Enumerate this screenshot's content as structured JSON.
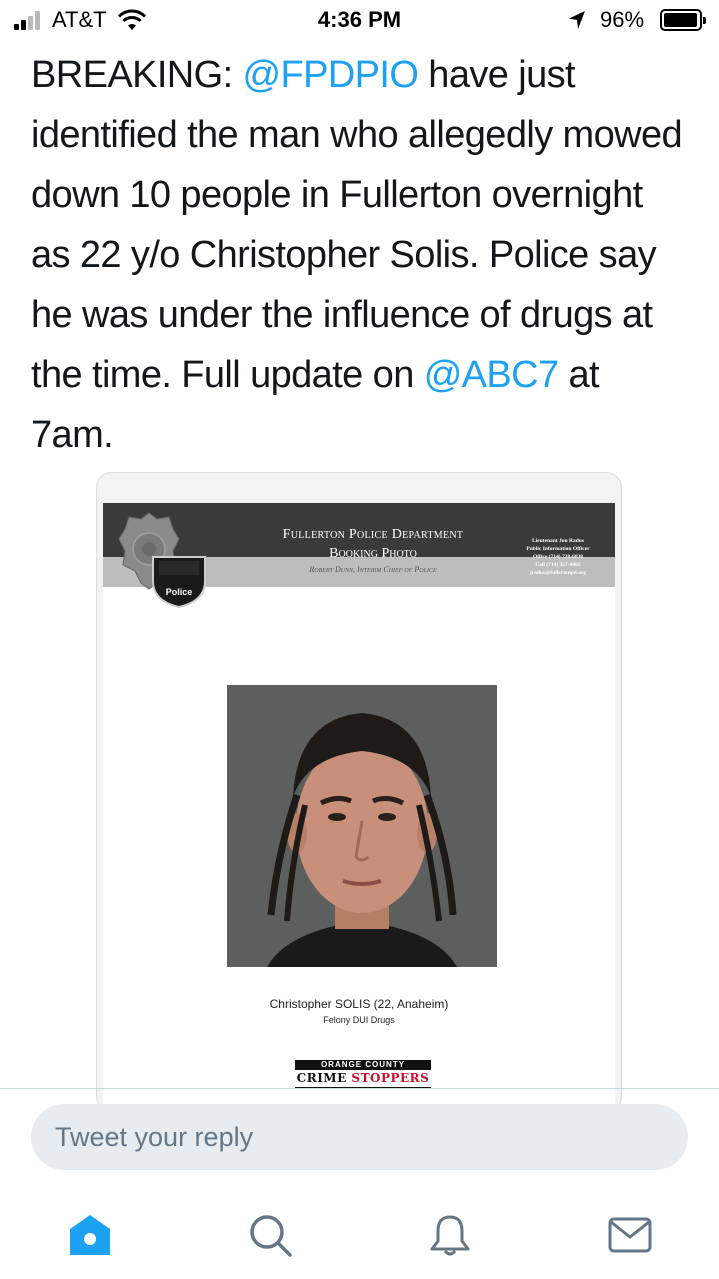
{
  "status_bar": {
    "carrier": "AT&T",
    "time": "4:36 PM",
    "battery_percent": "96%",
    "battery_level": 0.96,
    "signal_bars_filled": 2,
    "signal_bars_total": 4
  },
  "tweet": {
    "segments": [
      {
        "text": "BREAKING: ",
        "type": "text"
      },
      {
        "text": "@FPDPIO",
        "type": "mention"
      },
      {
        "text": " have just identified the man who allegedly mowed down 10 people in Fullerton overnight as 22 y/o Christopher Solis. Police say he was under the influence of drugs at the time. Full update on ",
        "type": "text"
      },
      {
        "text": "@ABC7",
        "type": "mention"
      },
      {
        "text": " at 7am.",
        "type": "text"
      }
    ]
  },
  "media": {
    "department_title": "Fullerton Police Department",
    "department_subtitle": "Booking Photo",
    "chief_line": "Robert Dunn, Interim Chief of Police",
    "patch_text": "Police",
    "contact_lines": [
      "Lieutenant Jon Radus",
      "Public Information Officer",
      "Office (714) 738-6838",
      "Cell (714) 357-4405",
      "jradus@fullertonpd.org"
    ],
    "caption_name": "Christopher SOLIS (22, Anaheim)",
    "caption_charge": "Felony DUI Drugs",
    "crime_stoppers_top": "ORANGE COUNTY",
    "crime_stoppers_crime": "CRIME ",
    "crime_stoppers_stoppers": "STOPPERS"
  },
  "composer": {
    "placeholder": "Tweet your reply"
  },
  "tab_bar": {
    "tabs": [
      {
        "icon": "home-icon",
        "active": true
      },
      {
        "icon": "search-icon",
        "active": false
      },
      {
        "icon": "notifications-icon",
        "active": false
      },
      {
        "icon": "messages-icon",
        "active": false
      }
    ]
  },
  "colors": {
    "mention": "#1da1f2",
    "active_tab": "#1da1f2",
    "inactive_tab": "#657786",
    "composer_bg": "#e6ecf0"
  }
}
